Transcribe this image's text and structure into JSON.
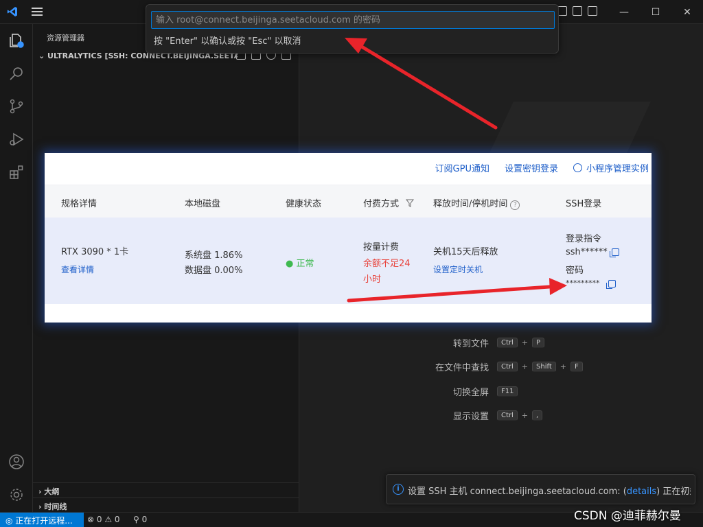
{
  "titlebar": {
    "controls": [
      "—",
      "☐",
      "✕"
    ]
  },
  "sidebar": {
    "title": "资源管理器",
    "folder": "ULTRALYTICS [SSH: CONNECT.BEIJINGA.SEETACLO...",
    "sections": [
      "大纲",
      "时间线"
    ]
  },
  "quick_input": {
    "placeholder": "输入 root@connect.beijinga.seetacloud.com 的密码",
    "message": "按 \"Enter\" 以确认或按 \"Esc\" 以取消"
  },
  "welcome": {
    "shortcuts": [
      {
        "label": "转到文件",
        "keys": [
          "Ctrl",
          "P"
        ]
      },
      {
        "label": "在文件中查找",
        "keys": [
          "Ctrl",
          "Shift",
          "F"
        ]
      },
      {
        "label": "切换全屏",
        "keys": [
          "F11"
        ]
      },
      {
        "label": "显示设置",
        "keys": [
          "Ctrl",
          ","
        ]
      }
    ]
  },
  "panel": {
    "links": [
      "订阅GPU通知",
      "设置密钥登录",
      "小程序管理实例"
    ],
    "headers": [
      "规格详情",
      "本地磁盘",
      "健康状态",
      "付费方式",
      "释放时间/停机时间",
      "SSH登录"
    ],
    "row": {
      "spec": "RTX 3090 * 1卡",
      "spec_link": "查看详情",
      "disk_system": "系统盘 1.86%",
      "disk_data": "数据盘 0.00%",
      "health": "正常",
      "billing": "按量计费",
      "billing_warning_1": "余额不足24",
      "billing_warning_2": "小时",
      "release": "关机15天后释放",
      "release_link": "设置定时关机",
      "ssh_cmd_label": "登录指令",
      "ssh_cmd": "ssh******",
      "ssh_pwd_label": "密码",
      "ssh_pwd": "*********"
    }
  },
  "notification": {
    "prefix": "设置 SSH 主机 connect.beijinga.seetacloud.com: (",
    "link": "details",
    "suffix": ") 正在初始化 V..."
  },
  "statusbar": {
    "remote": "正在打开远程...",
    "problems": "⊗ 0 ⚠ 0",
    "ports": "0"
  },
  "watermark_text": "CSDN @迪菲赫尔曼",
  "colors": {
    "accent": "#0078d4",
    "link": "#1d5ec9",
    "arrow": "#e8242a"
  }
}
